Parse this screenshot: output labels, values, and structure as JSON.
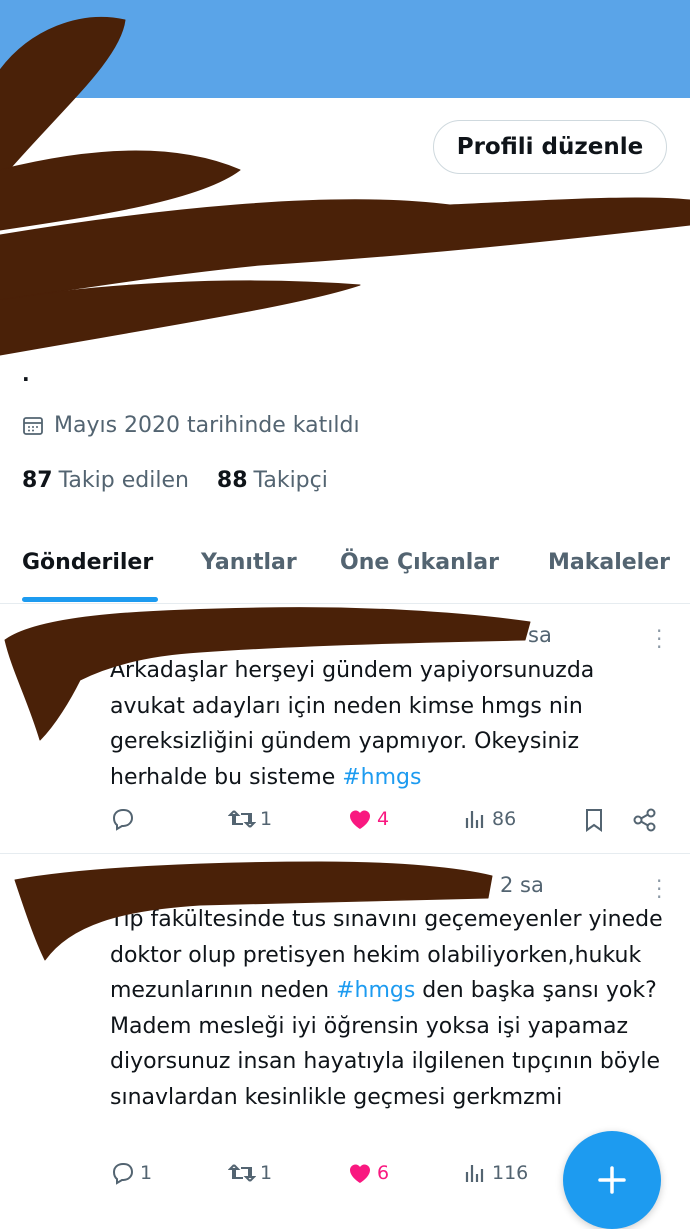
{
  "profile": {
    "edit_button": "Profili düzenle",
    "bio_dot": ".",
    "joined": "Mayıs 2020 tarihinde katıldı",
    "following_count": "87",
    "following_label": "Takip edilen",
    "followers_count": "88",
    "followers_label": "Takipçi"
  },
  "tabs": [
    {
      "label": "Gönderiler"
    },
    {
      "label": "Yanıtlar"
    },
    {
      "label": "Öne Çıkanlar"
    },
    {
      "label": "Makaleler"
    }
  ],
  "posts": [
    {
      "time": "sa",
      "text": "Arkadaşlar herşeyi gündem yapiyorsunuzda avukat adayları için neden kimse hmgs nin gereksizliğini gündem yapmıyor. Okeysiniz herhalde bu sisteme ",
      "hashtag": "#hmgs",
      "replies": "",
      "reposts": "1",
      "likes": "4",
      "views": "86"
    },
    {
      "time": "2 sa",
      "text_before": "Tıp fakültesinde tus sınavını geçemeyenler yinede doktor olup pretisyen hekim olabiliyorken,hukuk mezunlarının neden ",
      "hashtag": "#hmgs",
      "text_after": " den başka şansı yok? Madem mesleği iyi öğrensin yoksa işi yapamaz diyorsunuz insan hayatıyla ilgilenen tıpçının böyle sınavlardan kesinlikle geçmesi gerkmzmi",
      "replies": "1",
      "reposts": "1",
      "likes": "6",
      "views": "116"
    }
  ],
  "colors": {
    "banner": "#5aa4e8",
    "accent": "#1d9bf0",
    "like": "#f91880",
    "redaction": "#4a2108"
  },
  "icons": [
    "calendar-icon",
    "reply-icon",
    "repost-icon",
    "heart-icon",
    "views-icon",
    "bookmark-icon",
    "share-icon",
    "more-icon",
    "plus-icon"
  ]
}
